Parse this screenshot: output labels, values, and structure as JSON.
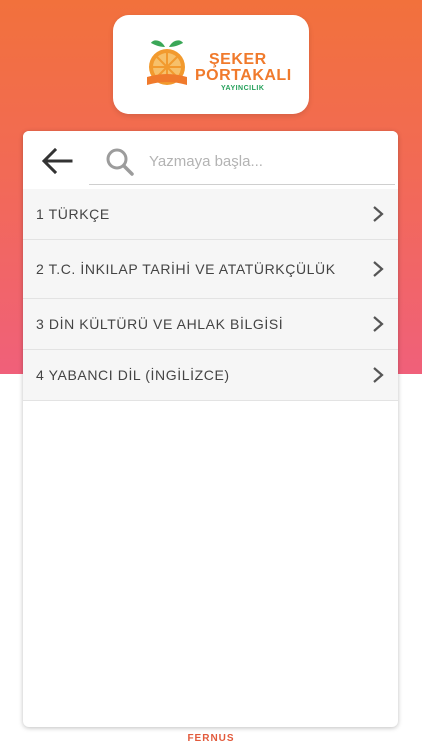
{
  "brand": {
    "line1": "ŞEKER",
    "line2": "PORTAKALI",
    "line3": "YAYINCILIK",
    "primary_color": "#f07a2c",
    "secondary_color": "#24a05a",
    "gradient_top": "#f2713c",
    "gradient_bottom": "#f0607a"
  },
  "search": {
    "placeholder": "Yazmaya başla...",
    "value": ""
  },
  "icons": {
    "back": "arrow-left-icon",
    "search": "magnifier-icon",
    "chevron": "chevron-right-icon"
  },
  "list": {
    "items": [
      {
        "label": "1 TÜRKÇE"
      },
      {
        "label": "2 T.C. İNKILAP TARİHİ VE ATATÜRKÇÜLÜK"
      },
      {
        "label": "3 DİN KÜLTÜRÜ VE AHLAK BİLGİSİ"
      },
      {
        "label": "4 YABANCI DİL (İNGİLİZCE)"
      }
    ]
  },
  "footer": {
    "text": "FERNUS"
  }
}
